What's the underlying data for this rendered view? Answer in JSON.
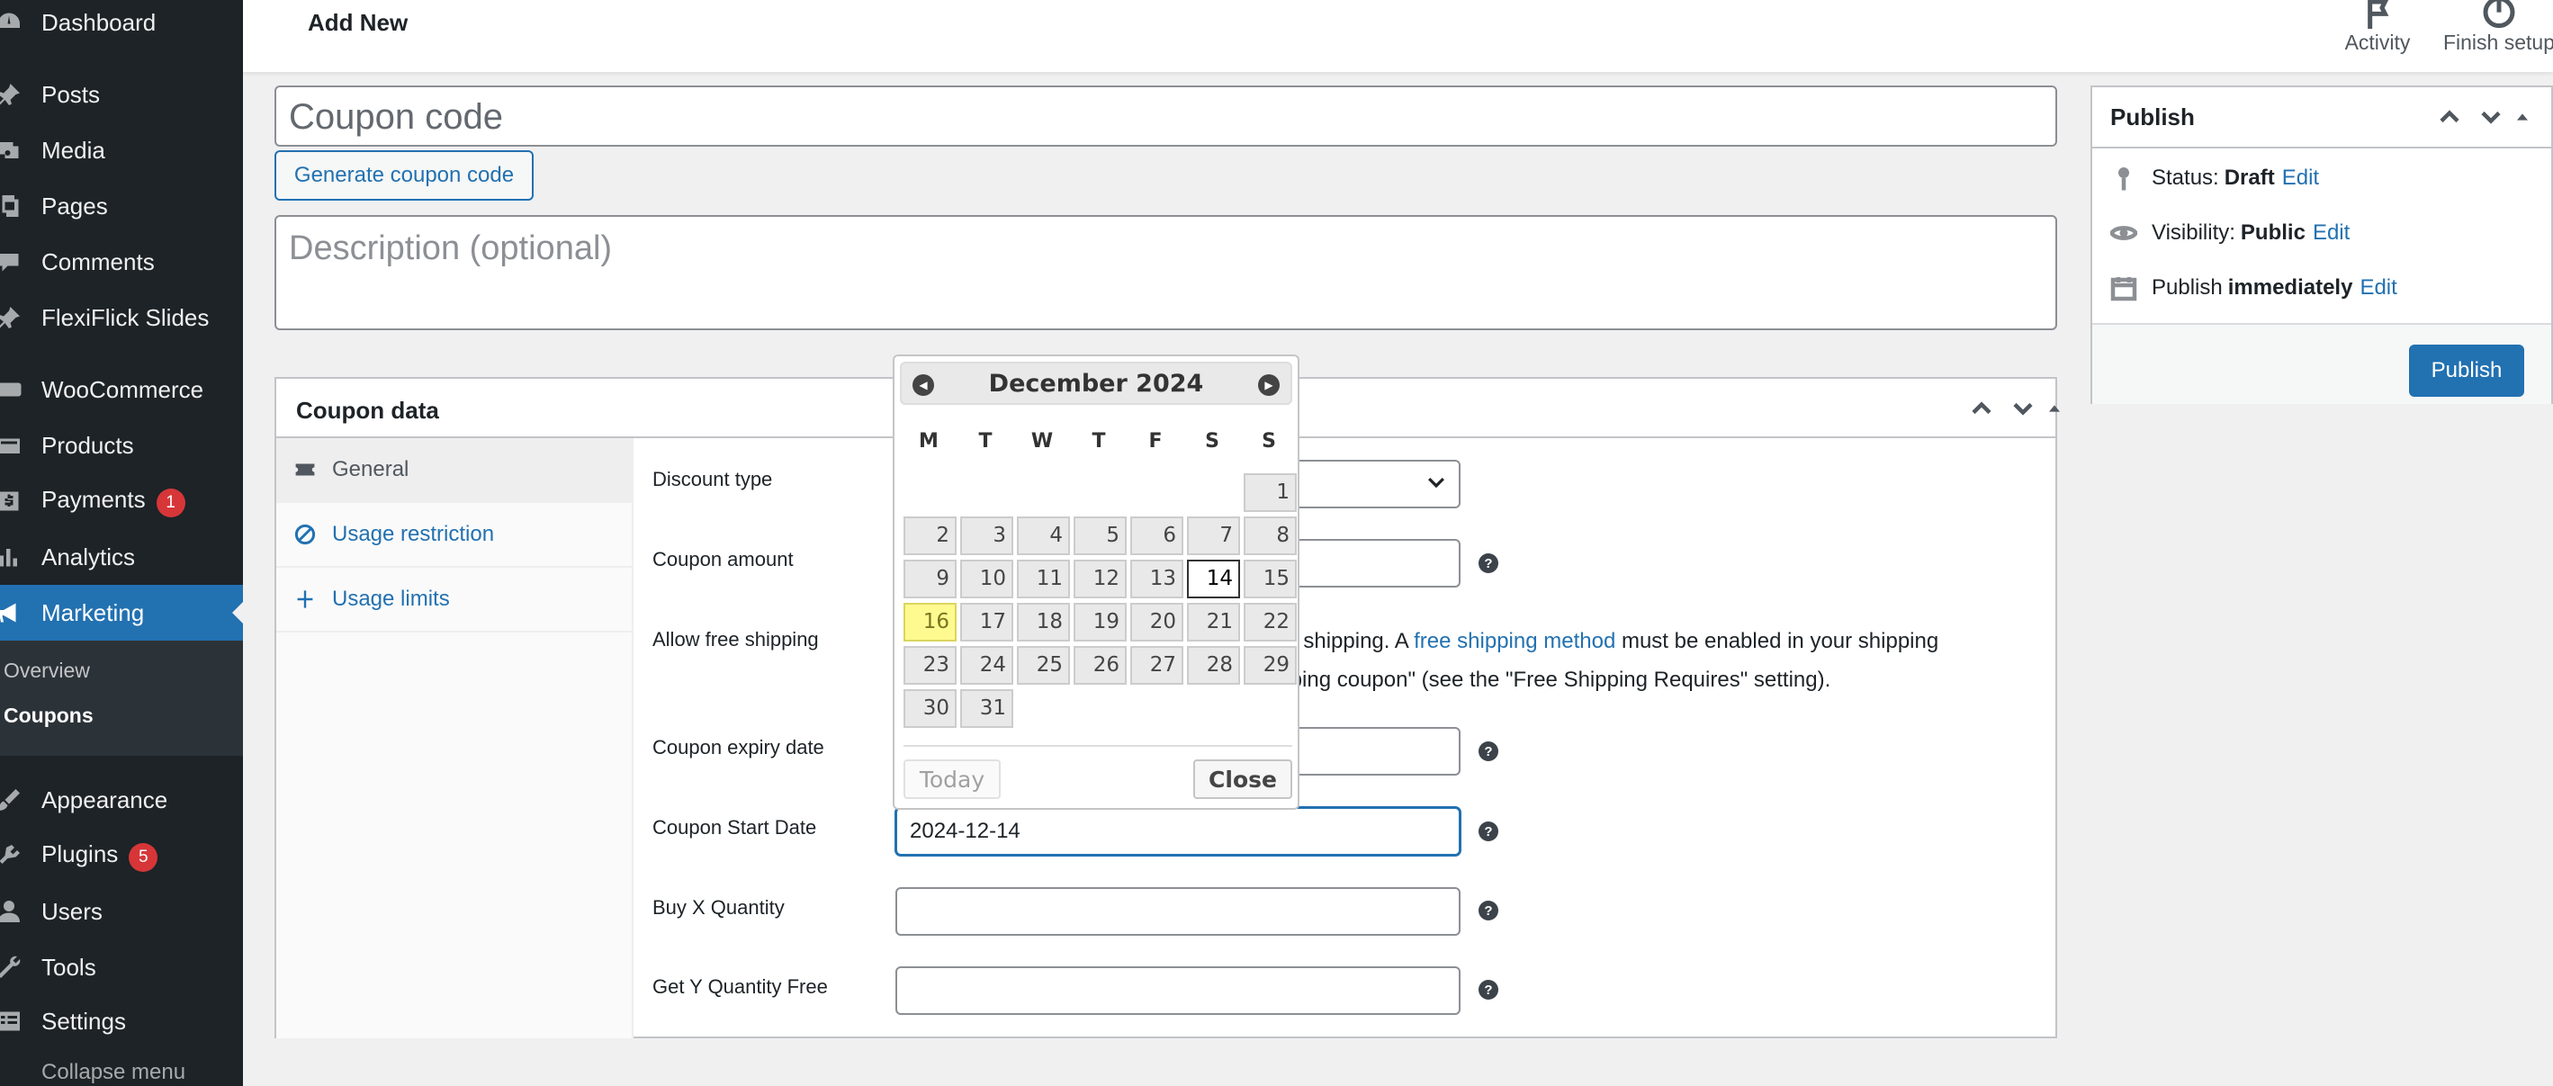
{
  "sidebar": {
    "items": [
      {
        "label": "Dashboard",
        "icon": "dashboard-icon"
      },
      {
        "label": "Posts",
        "icon": "pin-icon"
      },
      {
        "label": "Media",
        "icon": "media-icon"
      },
      {
        "label": "Pages",
        "icon": "pages-icon"
      },
      {
        "label": "Comments",
        "icon": "comments-icon"
      },
      {
        "label": "FlexiFlick Slides",
        "icon": "pin-icon"
      },
      {
        "label": "WooCommerce",
        "icon": "woo-icon"
      },
      {
        "label": "Products",
        "icon": "products-icon"
      },
      {
        "label": "Payments",
        "icon": "payments-icon",
        "count": "1"
      },
      {
        "label": "Analytics",
        "icon": "analytics-icon"
      },
      {
        "label": "Marketing",
        "icon": "megaphone-icon"
      },
      {
        "label": "Appearance",
        "icon": "brush-icon"
      },
      {
        "label": "Plugins",
        "icon": "plugins-icon",
        "count": "5"
      },
      {
        "label": "Users",
        "icon": "users-icon"
      },
      {
        "label": "Tools",
        "icon": "tools-icon"
      },
      {
        "label": "Settings",
        "icon": "settings-icon"
      }
    ],
    "submenu": [
      "Overview",
      "Coupons"
    ],
    "collapse_label": "Collapse menu"
  },
  "topbar": {
    "title": "Add New",
    "activity_label": "Activity",
    "finish_label": "Finish setup"
  },
  "coupon": {
    "code_placeholder": "Coupon code",
    "generate_label": "Generate coupon code",
    "description_placeholder": "Description (optional)"
  },
  "coupon_data": {
    "title": "Coupon data",
    "tabs": [
      "General",
      "Usage restriction",
      "Usage limits"
    ],
    "fields": {
      "discount_type": "Discount type",
      "coupon_amount": "Coupon amount",
      "free_shipping": "Allow free shipping",
      "expiry": "Coupon expiry date",
      "start": "Coupon Start Date",
      "buy_x": "Buy X Quantity",
      "get_y": "Get Y Quantity Free"
    },
    "start_value": "2024-12-14",
    "shipping_text_1": "ee shipping. A ",
    "shipping_link": "free shipping method",
    "shipping_text_2": " must be enabled in your shipping",
    "shipping_text_3": "ipping coupon\" (see the \"Free Shipping Requires\" setting)."
  },
  "calendar": {
    "title": "December 2024",
    "weekdays": [
      "M",
      "T",
      "W",
      "T",
      "F",
      "S",
      "S"
    ],
    "days": [
      "1",
      "2",
      "3",
      "4",
      "5",
      "6",
      "7",
      "8",
      "9",
      "10",
      "11",
      "12",
      "13",
      "14",
      "15",
      "16",
      "17",
      "18",
      "19",
      "20",
      "21",
      "22",
      "23",
      "24",
      "25",
      "26",
      "27",
      "28",
      "29",
      "30",
      "31"
    ],
    "first_weekday_index": 6,
    "today": "16",
    "selected": "14",
    "today_label": "Today",
    "close_label": "Close"
  },
  "publish": {
    "title": "Publish",
    "status_label": "Status:",
    "status_value": "Draft",
    "visibility_label": "Visibility:",
    "visibility_value": "Public",
    "schedule_label": "Publish",
    "schedule_value": "immediately",
    "edit_label": "Edit",
    "button_label": "Publish"
  },
  "colors": {
    "sidebar_bg": "#1d2327",
    "accent": "#2271b1",
    "badge": "#d63638",
    "calendar_today": "#fffa90"
  }
}
